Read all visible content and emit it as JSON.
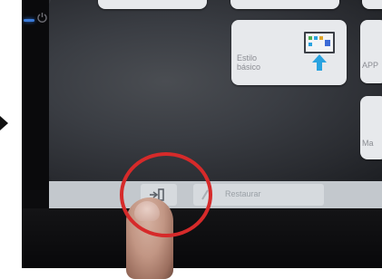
{
  "tiles": {
    "estilo_basico": {
      "label_line1": "Estilo",
      "label_line2": "básico",
      "icon": "presentation-screen-icon"
    },
    "app_partial": {
      "label": "APP"
    },
    "manual_partial": {
      "label": "Ma"
    }
  },
  "toolbar": {
    "exit_button_icon": "exit-door-icon",
    "restore_icon": "pencil-icon",
    "restore_label": "Restaurar"
  },
  "annotation": {
    "arrow_color": "#111111",
    "highlight_color": "#d62a2a"
  },
  "colors": {
    "tile_bg": "#e7e9ec",
    "toolbar_bg": "#c3c8cd",
    "icon_accent": "#2aa3e0"
  }
}
